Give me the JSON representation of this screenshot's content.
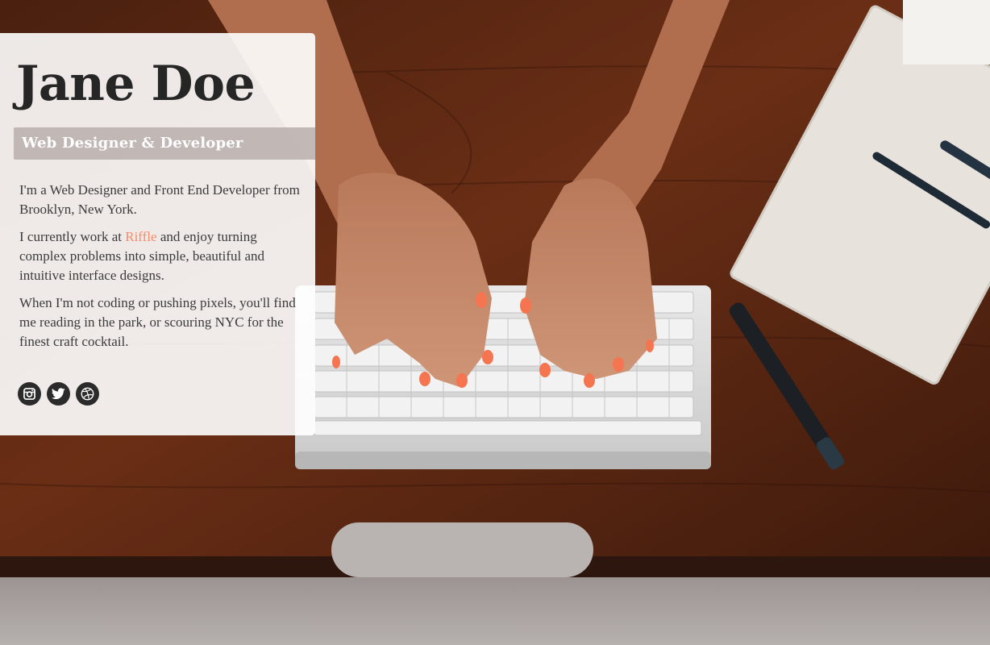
{
  "profile": {
    "name": "Jane Doe",
    "role": "Web Designer & Developer"
  },
  "bio": {
    "p1": "I'm a Web Designer and Front End Developer from Brooklyn, New York.",
    "p2_before": "I currently work at ",
    "p2_link": "Riffle",
    "p2_after": " and enjoy turning complex problems into simple, beautiful and intuitive interface designs.",
    "p3": "When I'm not coding or pushing pixels, you'll find me reading in the park, or scouring NYC for the finest craft cocktail."
  },
  "social": [
    {
      "icon": "instagram-icon"
    },
    {
      "icon": "twitter-icon"
    },
    {
      "icon": "dribbble-icon"
    }
  ],
  "colors": {
    "accent": "#f78b6a",
    "text": "#3b3b3b",
    "heading": "#262626"
  }
}
